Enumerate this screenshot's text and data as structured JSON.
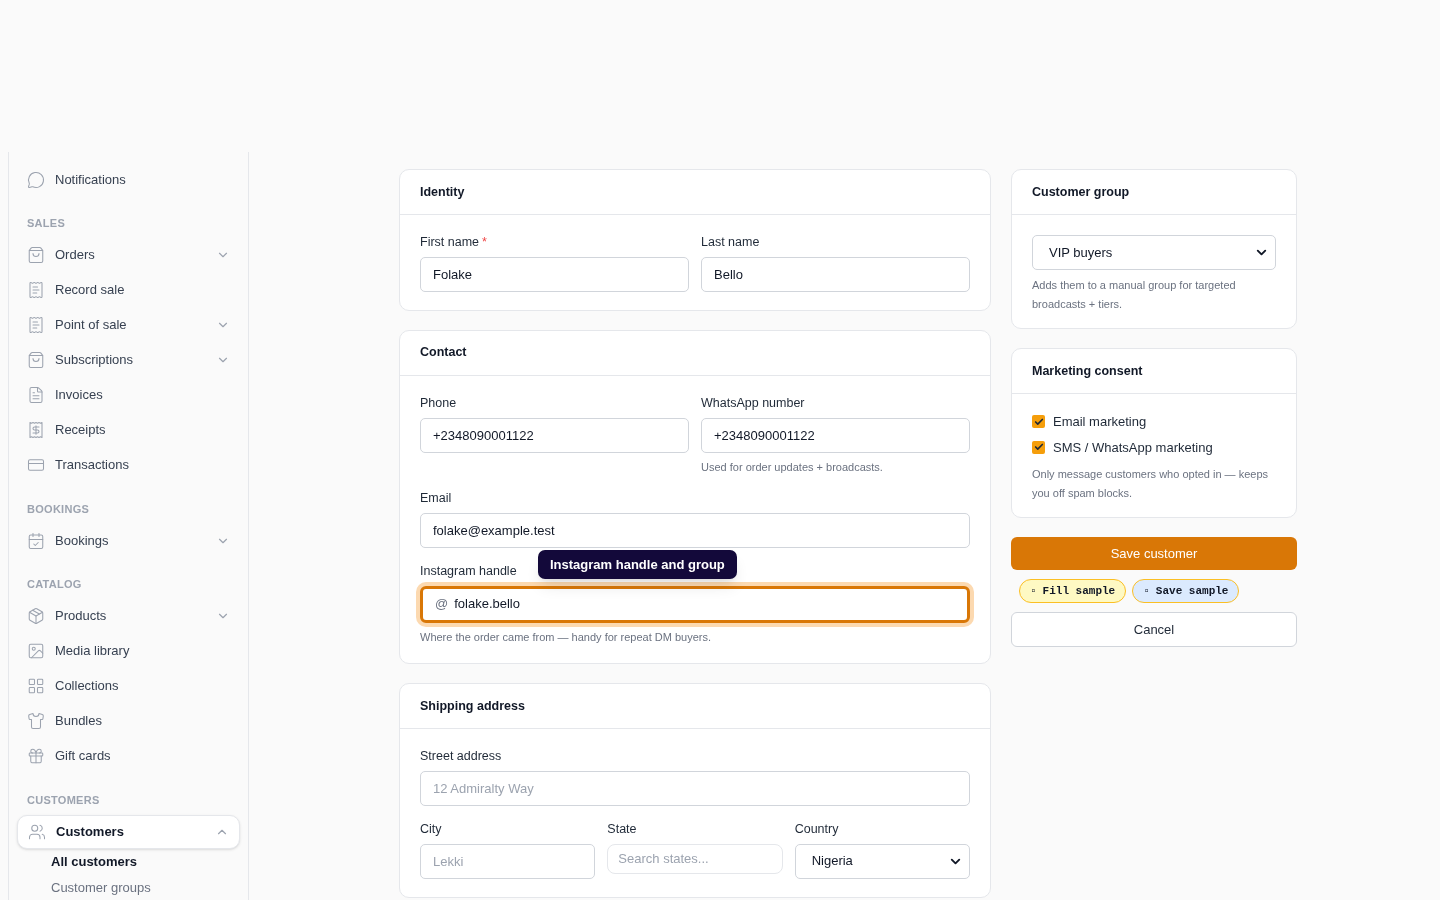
{
  "sidebar": [
    {
      "kind": "item",
      "label": "Notifications",
      "expandable": false
    },
    {
      "kind": "section",
      "label": "SALES"
    },
    {
      "kind": "item",
      "label": "Orders",
      "expandable": true
    },
    {
      "kind": "item",
      "label": "Record sale",
      "expandable": false
    },
    {
      "kind": "item",
      "label": "Point of sale",
      "expandable": true
    },
    {
      "kind": "item",
      "label": "Subscriptions",
      "expandable": true
    },
    {
      "kind": "item",
      "label": "Invoices",
      "expandable": false
    },
    {
      "kind": "item",
      "label": "Receipts",
      "expandable": false
    },
    {
      "kind": "item",
      "label": "Transactions",
      "expandable": false
    },
    {
      "kind": "section",
      "label": "BOOKINGS"
    },
    {
      "kind": "item",
      "label": "Bookings",
      "expandable": true
    },
    {
      "kind": "section",
      "label": "CATALOG"
    },
    {
      "kind": "item",
      "label": "Products",
      "expandable": true
    },
    {
      "kind": "item",
      "label": "Media library",
      "expandable": false
    },
    {
      "kind": "item",
      "label": "Collections",
      "expandable": false
    },
    {
      "kind": "item",
      "label": "Bundles",
      "expandable": false
    },
    {
      "kind": "item",
      "label": "Gift cards",
      "expandable": false
    },
    {
      "kind": "section",
      "label": "CUSTOMERS"
    },
    {
      "kind": "item",
      "label": "Customers",
      "expandable": true,
      "expanded": true,
      "selected": true,
      "children": [
        {
          "label": "All customers",
          "selected": true
        },
        {
          "label": "Customer groups",
          "selected": false
        }
      ]
    }
  ],
  "cards": [
    {
      "title": "Identity",
      "rows": [
        [
          {
            "kind": "text",
            "label": "First name",
            "required": true,
            "value": "Folake"
          },
          {
            "kind": "text",
            "label": "Last name",
            "value": "Bello"
          }
        ]
      ]
    },
    {
      "title": "Contact",
      "rows": [
        [
          {
            "kind": "text",
            "label": "Phone",
            "value": "+2348090001122"
          },
          {
            "kind": "text",
            "label": "WhatsApp number",
            "value": "+2348090001122",
            "hint": "Used for order updates + broadcasts."
          }
        ],
        [
          {
            "kind": "text",
            "label": "Email",
            "value": "folake@example.test"
          }
        ],
        [
          {
            "kind": "prefixed",
            "label": "Instagram handle",
            "prefix": "@",
            "value": "folake.bello",
            "focused": true,
            "tooltip": "Instagram handle and group",
            "hint": "Where the order came from — handy for repeat DM buyers."
          }
        ]
      ]
    },
    {
      "title": "Shipping address",
      "rows": [
        [
          {
            "kind": "text",
            "label": "Street address",
            "placeholder": "12 Admiralty Way"
          }
        ],
        [
          {
            "kind": "text",
            "label": "City",
            "placeholder": "Lekki"
          },
          {
            "kind": "search",
            "label": "State",
            "placeholder": "Search states..."
          },
          {
            "kind": "select",
            "label": "Country",
            "value": "Nigeria"
          }
        ]
      ]
    }
  ],
  "customer_group": {
    "title": "Customer group",
    "value": "VIP buyers",
    "hint": "Adds them to a manual group for targeted broadcasts + tiers."
  },
  "marketing_consent": {
    "title": "Marketing consent",
    "options": [
      {
        "label": "Email marketing",
        "checked": true
      },
      {
        "label": "SMS / WhatsApp marketing",
        "checked": true
      }
    ],
    "hint": "Only message customers who opted in — keeps you off spam blocks."
  },
  "save_button": "Save customer",
  "sample_chips": [
    {
      "icon": "▫",
      "label": "Fill sample",
      "color": "#fef9c3"
    },
    {
      "icon": "▫",
      "label": "Save sample",
      "color": "#dbeafe"
    }
  ],
  "cancel_button": "Cancel",
  "required_mark": "*"
}
